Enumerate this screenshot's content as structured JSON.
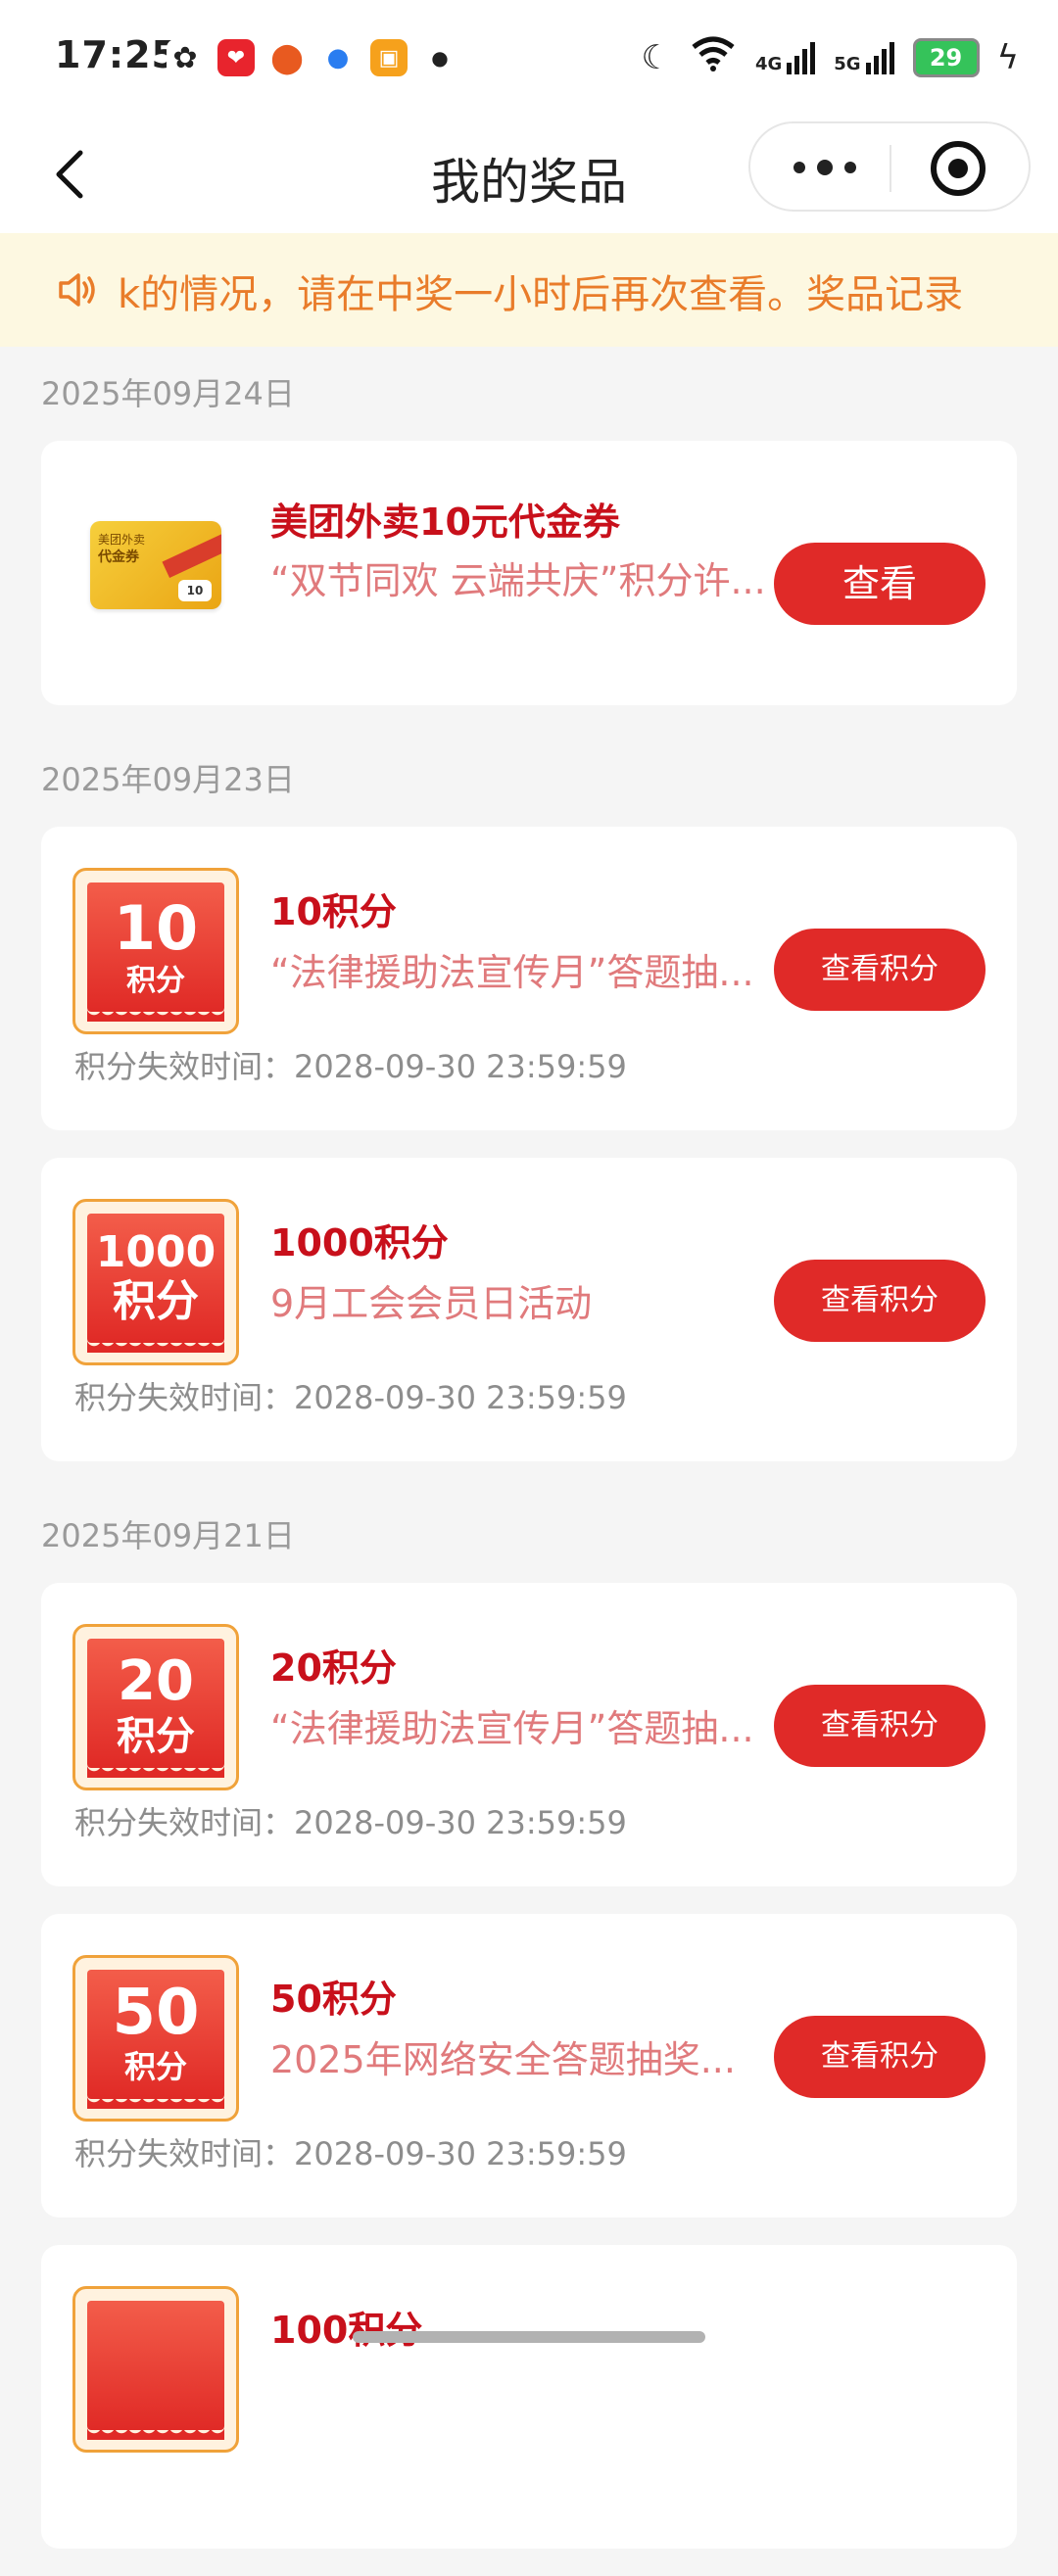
{
  "status": {
    "time": "17:25",
    "battery": "29",
    "net1": "4G",
    "net2": "5G"
  },
  "nav": {
    "title": "我的奖品"
  },
  "notice": {
    "text": "k的情况，请在中奖一小时后再次查看。奖品记录"
  },
  "groups": [
    {
      "date": "2025年09月24日",
      "items": [
        {
          "title": "美团外卖10元代金券",
          "subtitle": "“双节同欢 云端共庆”积分许...",
          "button": "查看",
          "thumb_t1": "美团外卖",
          "thumb_t2": "代金券",
          "thumb_value": "10"
        }
      ]
    },
    {
      "date": "2025年09月23日",
      "items": [
        {
          "badge_num": "10",
          "badge_unit": "积分",
          "title": "10积分",
          "subtitle": "“法律援助法宣传月”答题抽...",
          "expire": "积分失效时间：2028-09-30 23:59:59",
          "button": "查看积分"
        },
        {
          "badge_num": "1000",
          "badge_unit": "积分",
          "title": "1000积分",
          "subtitle": "9月工会会员日活动",
          "expire": "积分失效时间：2028-09-30 23:59:59",
          "button": "查看积分"
        }
      ]
    },
    {
      "date": "2025年09月21日",
      "items": [
        {
          "badge_num": "20",
          "badge_unit": "积分",
          "title": "20积分",
          "subtitle": "“法律援助法宣传月”答题抽...",
          "expire": "积分失效时间：2028-09-30 23:59:59",
          "button": "查看积分"
        },
        {
          "badge_num": "50",
          "badge_unit": "积分",
          "title": "50积分",
          "subtitle": "2025年网络安全答题抽奖...",
          "expire": "积分失效时间：2028-09-30 23:59:59",
          "button": "查看积分"
        },
        {
          "badge_num": "",
          "badge_unit": "",
          "title": "100积分",
          "subtitle": "",
          "expire": "",
          "button": ""
        }
      ]
    }
  ],
  "colors": {
    "accent": "#e02a28",
    "title_red": "#c8101b",
    "notice_bg": "#fdf8e1",
    "notice_text": "#e97c2a",
    "badge_border": "#f0a23a"
  },
  "icons": [
    "back-chevron-icon",
    "more-dots-icon",
    "target-icon",
    "speaker-icon",
    "moon-icon",
    "wifi-icon",
    "signal-icon",
    "battery-icon",
    "charging-icon"
  ]
}
